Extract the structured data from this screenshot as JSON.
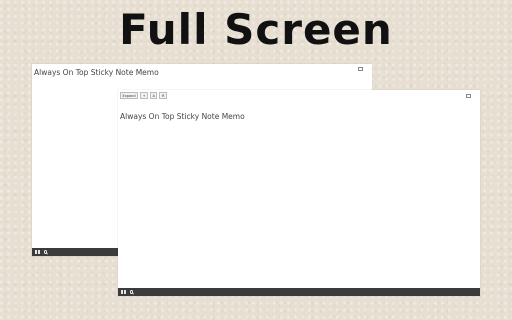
{
  "headline": "Full Screen",
  "back_window": {
    "title": "Always On Top Sticky Note Memo"
  },
  "front_window": {
    "toolbar": [
      "Expand",
      "+",
      "A",
      "R"
    ],
    "title": "Always On Top Sticky Note Memo"
  },
  "taskbar": {
    "start_icon": "windows-logo-icon",
    "search_icon": "search-icon"
  }
}
